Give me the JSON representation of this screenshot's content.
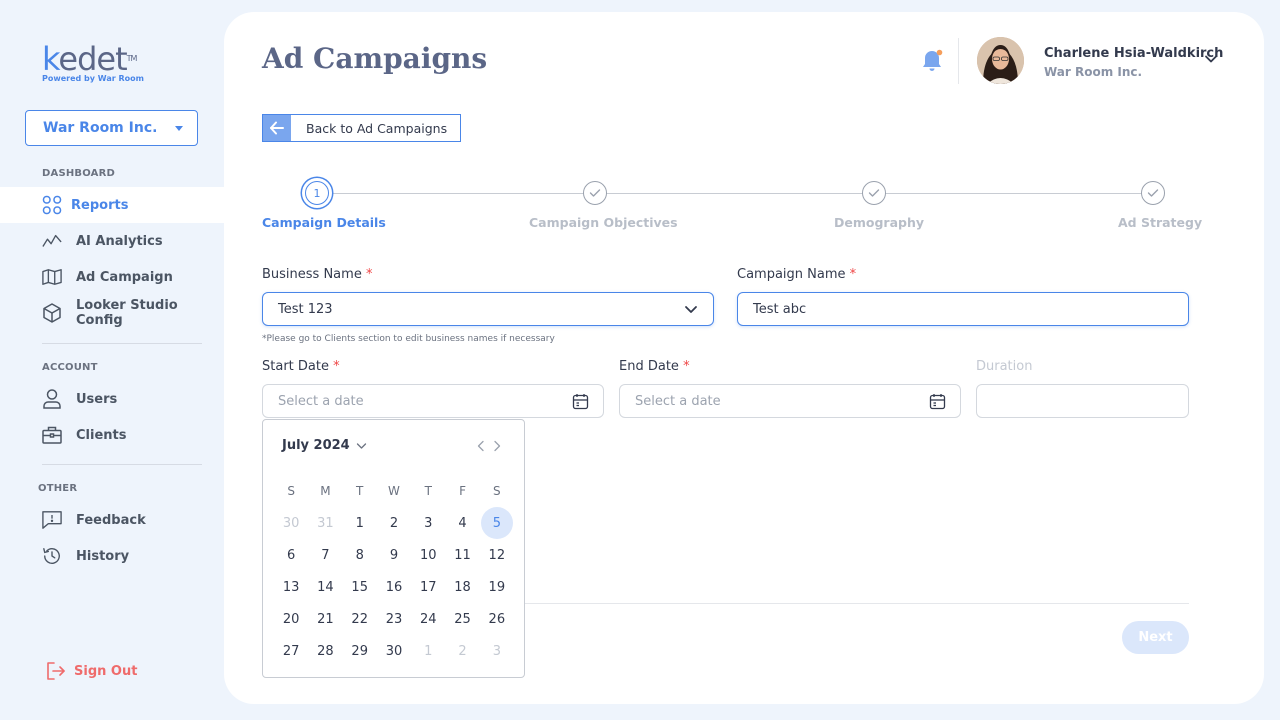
{
  "brand": {
    "logo_k": "k",
    "logo_rest": "edet",
    "logo_tm": "TM",
    "tagline": "Powered by War Room"
  },
  "org_selector": {
    "value": "War Room Inc."
  },
  "sidebar": {
    "sections": [
      {
        "label": "DASHBOARD"
      },
      {
        "label": "ACCOUNT"
      },
      {
        "label": "OTHER"
      }
    ],
    "items": [
      {
        "label": "Reports",
        "icon": "grid-icon"
      },
      {
        "label": "AI Analytics",
        "icon": "activity-icon"
      },
      {
        "label": "Ad Campaign",
        "icon": "map-icon"
      },
      {
        "label": "Looker Studio Config",
        "icon": "cube-icon"
      },
      {
        "label": "Users",
        "icon": "user-icon"
      },
      {
        "label": "Clients",
        "icon": "briefcase-icon"
      },
      {
        "label": "Feedback",
        "icon": "feedback-icon"
      },
      {
        "label": "History",
        "icon": "history-icon"
      }
    ],
    "signout": "Sign Out"
  },
  "header": {
    "title": "Ad Campaigns",
    "user_name": "Charlene Hsia-Waldkirch",
    "user_org": "War Room Inc."
  },
  "back_button": "Back to Ad Campaigns",
  "stepper": {
    "active_number": "1",
    "steps": [
      "Campaign Details",
      "Campaign Objectives",
      "Demography",
      "Ad Strategy"
    ]
  },
  "form": {
    "business_name": {
      "label": "Business Name",
      "value": "Test 123",
      "hint": "*Please go to Clients section to edit business names if necessary"
    },
    "campaign_name": {
      "label": "Campaign Name",
      "value": "Test abc"
    },
    "start_date": {
      "label": "Start Date",
      "placeholder": "Select a date"
    },
    "end_date": {
      "label": "End Date",
      "placeholder": "Select a date"
    },
    "duration": {
      "label": "Duration",
      "value": ""
    },
    "required_mark": "*"
  },
  "calendar": {
    "month": "July 2024",
    "weekdays": [
      "S",
      "M",
      "T",
      "W",
      "T",
      "F",
      "S"
    ],
    "weeks": [
      [
        {
          "d": "30",
          "out": true
        },
        {
          "d": "31",
          "out": true
        },
        {
          "d": "1"
        },
        {
          "d": "2"
        },
        {
          "d": "3"
        },
        {
          "d": "4"
        },
        {
          "d": "5",
          "sel": true
        }
      ],
      [
        {
          "d": "6"
        },
        {
          "d": "7"
        },
        {
          "d": "8"
        },
        {
          "d": "9"
        },
        {
          "d": "10"
        },
        {
          "d": "11"
        },
        {
          "d": "12"
        }
      ],
      [
        {
          "d": "13"
        },
        {
          "d": "14"
        },
        {
          "d": "15"
        },
        {
          "d": "16"
        },
        {
          "d": "17"
        },
        {
          "d": "18"
        },
        {
          "d": "19"
        }
      ],
      [
        {
          "d": "20"
        },
        {
          "d": "21"
        },
        {
          "d": "22"
        },
        {
          "d": "23"
        },
        {
          "d": "24"
        },
        {
          "d": "25"
        },
        {
          "d": "26"
        }
      ],
      [
        {
          "d": "27"
        },
        {
          "d": "28"
        },
        {
          "d": "29"
        },
        {
          "d": "30"
        },
        {
          "d": "1",
          "out": true
        },
        {
          "d": "2",
          "out": true
        },
        {
          "d": "3",
          "out": true
        }
      ]
    ]
  },
  "next_button": "Next",
  "colors": {
    "accent": "#4a86e8",
    "danger": "#ef6b6b",
    "notification_dot": "#f59e5b"
  }
}
